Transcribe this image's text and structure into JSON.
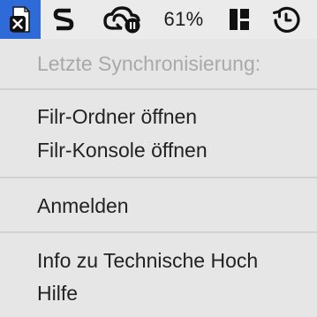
{
  "menubar": {
    "items": [
      {
        "icon": "filr-error-document-icon",
        "highlighted": true
      },
      {
        "icon": "scribe-s-icon"
      },
      {
        "icon": "creative-cloud-paused-icon"
      },
      {
        "icon": "battery-icon",
        "label": "61%"
      },
      {
        "icon": "window-layout-icon"
      },
      {
        "icon": "time-machine-icon"
      }
    ]
  },
  "menu": {
    "last_sync_label": "Letzte Synchronisierung:",
    "items": [
      {
        "label": "Filr-Ordner öffnen"
      },
      {
        "label": "Filr-Konsole öffnen"
      },
      {
        "label": "Anmelden"
      },
      {
        "label": "Info zu Technische Hoch"
      },
      {
        "label": "Hilfe"
      }
    ]
  },
  "colors": {
    "highlight": "#2e6bd9",
    "menu_background": "#e6e6e6",
    "text": "#222222",
    "disabled_text": "#a9a9a9",
    "separator": "#d2d2d2"
  }
}
